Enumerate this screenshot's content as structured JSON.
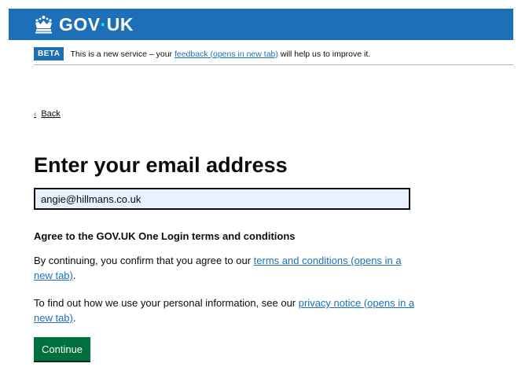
{
  "header": {
    "logo_text_prefix": "GOV",
    "logo_dot": "·",
    "logo_text_suffix": "UK",
    "logo_icon": "crown-icon",
    "background_color": "#1d70b8"
  },
  "phase_banner": {
    "tag": "BETA",
    "text_before": "This is a new service – your ",
    "feedback_link": "feedback (opens in new tab)",
    "text_after": " will help us to improve it."
  },
  "back_link": {
    "chevron": "‹",
    "label": "Back"
  },
  "page_title": "Enter your email address",
  "email_field": {
    "value": "angie@hillmans.co.uk"
  },
  "terms": {
    "heading": "Agree to the GOV.UK One Login terms and conditions",
    "para1_before": "By continuing, you confirm that you agree to our ",
    "terms_link": "terms and conditions (opens in a new tab)",
    "para1_after": ".",
    "para2_before": "To find out how we use your personal information, see our ",
    "privacy_link": "privacy notice (opens in a new tab)",
    "para2_after": "."
  },
  "continue_button": {
    "label": "Continue",
    "color": "#00703c"
  },
  "colors": {
    "link": "#1d70b8",
    "text": "#0b0c0c"
  }
}
